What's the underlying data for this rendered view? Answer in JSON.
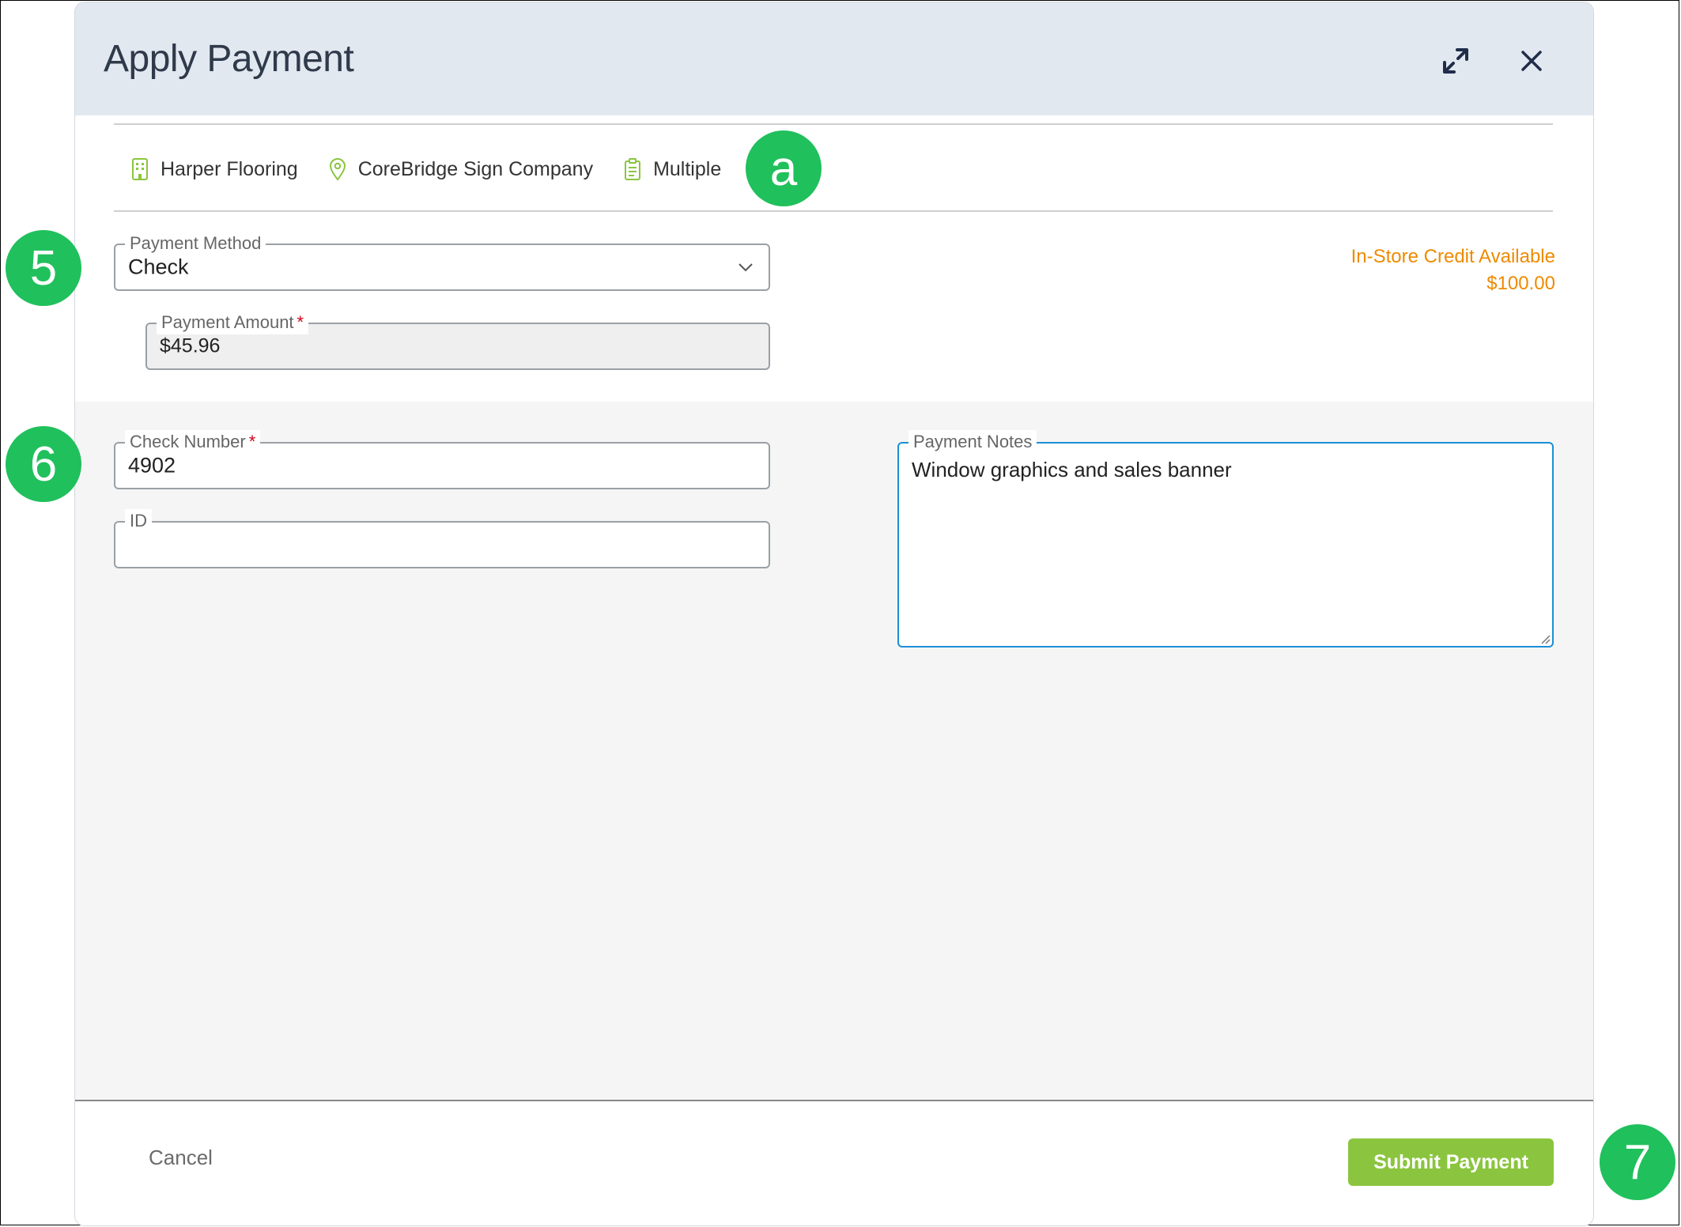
{
  "modal": {
    "title": "Apply Payment"
  },
  "info": {
    "company": "Harper Flooring",
    "location": "CoreBridge Sign Company",
    "orders": "Multiple"
  },
  "payment_method": {
    "label": "Payment Method",
    "value": "Check"
  },
  "credit": {
    "label": "In-Store Credit Available",
    "amount": "$100.00"
  },
  "payment_amount": {
    "label": "Payment Amount",
    "required_mark": "*",
    "value": "$45.96"
  },
  "check_number": {
    "label": "Check Number",
    "required_mark": "*",
    "value": "4902"
  },
  "id_field": {
    "label": "ID",
    "value": ""
  },
  "payment_notes": {
    "label": "Payment Notes",
    "value": "Window graphics and sales banner"
  },
  "footer": {
    "cancel_label": "Cancel",
    "submit_label": "Submit Payment"
  },
  "markers": {
    "a": "a",
    "five": "5",
    "six": "6",
    "seven": "7"
  },
  "colors": {
    "header_bg": "#e2e8f0",
    "accent_green": "#8bc53f",
    "credit_orange": "#ee8a00",
    "marker_green": "#20c05c",
    "focus_blue": "#1a8fd6"
  },
  "icons": {
    "expand": "expand-icon",
    "close": "close-icon",
    "company": "building-icon",
    "location": "map-pin-icon",
    "orders": "clipboard-icon",
    "dropdown": "chevron-down-icon"
  }
}
